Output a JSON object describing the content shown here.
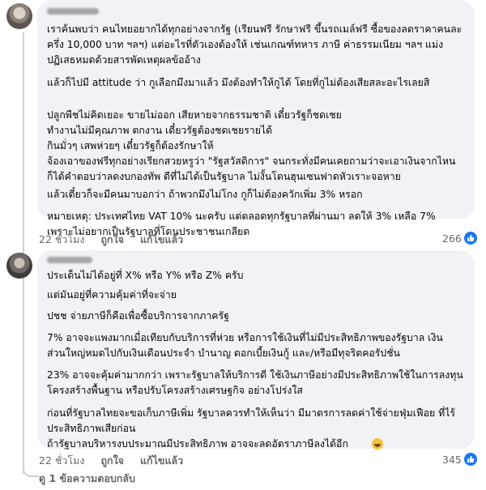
{
  "comments": [
    {
      "paragraphs": [
        "เราค้นพบว่า คนไทยอยากได้ทุกอย่างจากรัฐ (เรียนฟรี รักษาฟรี ขึ้นรถเมล์ฟรี ซื้อของลดราคาคนละ\nครึ่ง 10,000 บาท ฯลฯ) แต่อะไรที่ตัวเองต้องให้ เช่นเกณฑ์ทหาร ภาษี ค่าธรรมเนียม ฯลฯ แม่ง\nปฏิเสธหมดด้วยสารพัดเหตุผลข้ออ้าง",
        "แล้วก็ไปมี attitude ว่า กูเลือกมึงมาแล้ว มึงต้องทำให้กูได้ โดยที่กูไม่ต้องเสียสละอะไรเลยสิ",
        "ปลูกพืชไม่คิดเยอะ ขายไม่ออก เสียหายจากธรรมชาติ เดี๋ยวรัฐก็ชดเชย\nทำงานไม่มีคุณภาพ ตกงาน เดี๋ยวรัฐต้องชดเชยรายได้\nกินมั่วๆ เสพห่วยๆ เดี๋ยวรัฐก็ต้องรักษาให้",
        "จ้องเอาของฟรีทุกอย่างเรียกสวยหรูว่า \"รัฐสวัสดิการ\" จนกระทั่งมีคนเคยถามว่าจะเอาเงินจากไหน\nก็ได้คำตอบว่าลดงบกองทัพ ดีที่ไม่ได้เป็นรัฐบาล ไม่งั้นโดนฮุนเซนฟาดหัวเราะจอหาย",
        "แล้วเดี๋ยวก็จะมีคนมาบอกว่า ถ้าพวกมึงไม่โกง กูก็ไม่ต้องควักเพิ่ม 3% หรอก",
        "หมายเหตุ: ประเทศไทย VAT 10% นะครับ แต่ตลอดทุกรัฐบาลที่ผ่านมา ลดให้ 3% เหลือ 7%\nเพราะไม่อยากเป็นรัฐบาลที่โดนประชาชนเกลียด"
      ],
      "time": "22 ชั่วโมง",
      "like": "ถูกใจ",
      "reply": "แก้ไขแล้ว",
      "count": "266"
    },
    {
      "paragraphs": [
        "ประเด็นไม่ได้อยู่ที่ X% หรือ Y% หรือ Z% ครับ",
        "แต่มันอยู่ที่ความคุ้มค่าที่จะจ่าย",
        "ปชช จ่ายภาษีก็คือเพื่อซื้อบริการจากภาครัฐ",
        "7% อาจจะแพงมากเมื่อเทียบกับบริการที่ห่วย หรือการใช้เงินที่ไม่มีประสิทธิภาพของรัฐบาล เงิน\nส่วนใหญ่หมดไปกับเงินเดือนประจำ บำนาญ ดอกเบี้ยเงินกู้ และ/หรือมีทุจริตคอรัปชั่น",
        "23% อาจจะคุ้มค่ามากกว่า เพราะรัฐบาลให้บริการดี ใช้เงินภาษีอย่างมีประสิทธิภาพใช้ในการลงทุน\nโครงสร้างพื้นฐาน หรือปรับโครงสร้างเศรษฐกิจ อย่างโปร่งใส",
        "ก่อนที่รัฐบาลไทยจะขอเก็บภาษีเพิ่ม รัฐบาลควรทำให้เห็นว่า มีมาตรการลดค่าใช้จ่ายฟุ่มเฟือย ที่ไร้\nประสิทธิภาพเสียก่อน\nถ้ารัฐบาลบริหารงบประมาณมีประสิทธิภาพ อาจจะลดอัตราภาษีลงได้อีก"
      ],
      "time": "22 ชั่วโมง",
      "like": "ถูกใจ",
      "reply": "แก้ไขแล้ว",
      "count": "345"
    }
  ],
  "more_replies": "ดู 1 ข้อความตอบกลับ",
  "colors": {
    "bubble": "#f0f2f5",
    "meta": "#65676b",
    "like": "#1877f2"
  },
  "icons": [
    "like-icon",
    "laughing-emoji-icon"
  ]
}
